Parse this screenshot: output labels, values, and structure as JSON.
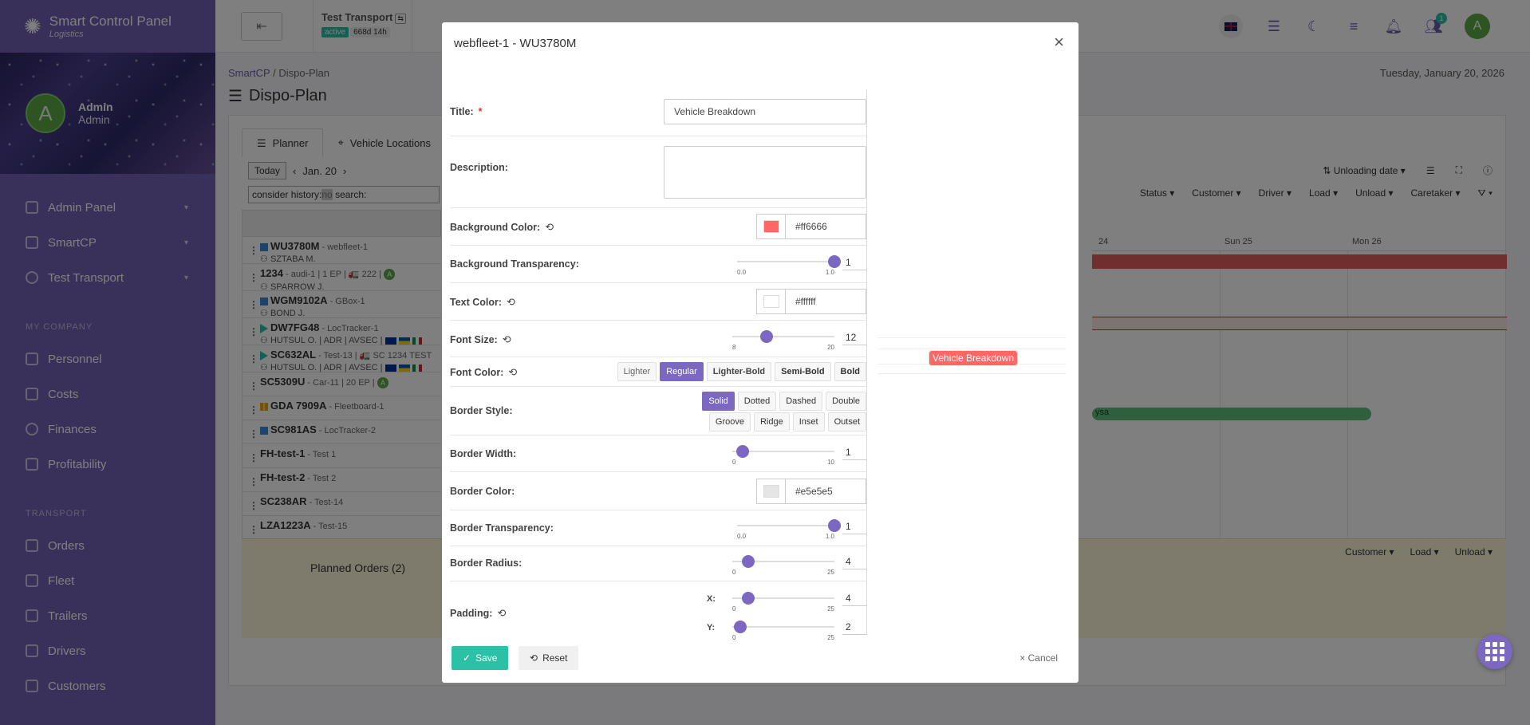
{
  "app": {
    "name": "Smart Control Panel",
    "sub": "Logistics"
  },
  "user": {
    "avatar": "A",
    "name": "Admin",
    "role": "Admin"
  },
  "sidebar": {
    "top": [
      {
        "label": "Admin Panel"
      },
      {
        "label": "SmartCP"
      },
      {
        "label": "Test Transport"
      }
    ],
    "sec1": "MY COMPANY",
    "company": [
      {
        "label": "Personnel"
      },
      {
        "label": "Costs"
      },
      {
        "label": "Finances"
      },
      {
        "label": "Profitability"
      }
    ],
    "sec2": "TRANSPORT",
    "transport": [
      {
        "label": "Orders"
      },
      {
        "label": "Fleet"
      },
      {
        "label": "Trailers"
      },
      {
        "label": "Drivers"
      },
      {
        "label": "Customers"
      }
    ]
  },
  "topbar": {
    "transport_title": "Test Transport",
    "status": "active",
    "duration": "668d 14h",
    "notif_count": "1",
    "user_avatar": "A"
  },
  "page": {
    "crumb_root": "SmartCP",
    "crumb_sep": "/",
    "crumb_current": "Dispo-Plan",
    "title": "Dispo-Plan",
    "date": "Tuesday, January 20, 2026"
  },
  "tabs": [
    "Planner",
    "Vehicle Locations"
  ],
  "planner": {
    "today": "Today",
    "current": "Jan. 20",
    "search_prefix": "consider history:",
    "search_no": "no",
    "search_label": "search:",
    "sort": "Unloading date",
    "filters": [
      "Status",
      "Customer",
      "Driver",
      "Load",
      "Unload",
      "Caretaker"
    ],
    "days": [
      "24",
      "Sun 25",
      "Mon 26"
    ],
    "green_bar_text": "ysa",
    "planned_orders": "Planned Orders (2)",
    "plan_filters": [
      "Customer",
      "Load",
      "Unload"
    ]
  },
  "vehicles": [
    {
      "plate": "WU3780M",
      "device": " - webfleet-1",
      "sub": "SZTABA M."
    },
    {
      "plate": "1234",
      "device": " - audi-1 | 1 EP | 🚛 222 |",
      "sub": "SPARROW J.",
      "badge": "A"
    },
    {
      "plate": "WGM9102A",
      "device": " - GBox-1",
      "sub": "BOND J."
    },
    {
      "plate": "DW7FG48",
      "device": " - LocTracker-1",
      "sub": "HUTSUL O. | ADR | AVSEC |"
    },
    {
      "plate": "SC632AL",
      "device": " - Test-13 | 🚛 SC 1234 TEST",
      "sub": "HUTSUL O. | ADR | AVSEC |"
    },
    {
      "plate": "SC5309U",
      "device": " - Car-11 | 20 EP |",
      "badge": "A"
    },
    {
      "plate": "GDA 7909A",
      "device": " - Fleetboard-1"
    },
    {
      "plate": "SC981AS",
      "device": " - LocTracker-2"
    },
    {
      "plate": "FH-test-1",
      "device": " - Test 1"
    },
    {
      "plate": "FH-test-2",
      "device": " - Test 2"
    },
    {
      "plate": "SC238AR",
      "device": " - Test-14"
    },
    {
      "plate": "LZA1223A",
      "device": " - Test-15"
    }
  ],
  "modal": {
    "title": "webfleet-1 - WU3780M",
    "labels": {
      "title": "Title:",
      "req": "*",
      "description": "Description:",
      "bg_color": "Background Color:",
      "bg_transp": "Background Transparency:",
      "text_color": "Text Color:",
      "font_size": "Font Size:",
      "font_color": "Font Color:",
      "border_style": "Border Style:",
      "border_width": "Border Width:",
      "border_color": "Border Color:",
      "border_transp": "Border Transparency:",
      "border_radius": "Border Radius:",
      "padding": "Padding:",
      "pad_x": "X:",
      "pad_y": "Y:"
    },
    "values": {
      "title": "Vehicle Breakdown",
      "description": "",
      "bg_color": "#ff6666",
      "bg_transp": "1",
      "text_color": "#ffffff",
      "font_size": "12",
      "border_width": "1",
      "border_color": "#e5e5e5",
      "border_transp": "1",
      "border_radius": "4",
      "pad_x": "4",
      "pad_y": "2"
    },
    "sliders": {
      "bg_transp": {
        "min": "0.0",
        "max": "1.0",
        "value": 1,
        "range": [
          0,
          1
        ]
      },
      "font_size": {
        "min": "8",
        "max": "20",
        "value": 12,
        "range": [
          8,
          20
        ]
      },
      "border_width": {
        "min": "0",
        "max": "10",
        "value": 1,
        "range": [
          0,
          10
        ]
      },
      "border_transp": {
        "min": "0.0",
        "max": "1.0",
        "value": 1,
        "range": [
          0,
          1
        ]
      },
      "border_radius": {
        "min": "0",
        "max": "25",
        "value": 4,
        "range": [
          0,
          25
        ]
      },
      "pad_x": {
        "min": "0",
        "max": "25",
        "value": 4,
        "range": [
          0,
          25
        ]
      },
      "pad_y": {
        "min": "0",
        "max": "25",
        "value": 2,
        "range": [
          0,
          25
        ]
      }
    },
    "font_weights": [
      "Lighter",
      "Regular",
      "Lighter-Bold",
      "Semi-Bold",
      "Bold"
    ],
    "font_weight_selected": "Regular",
    "border_styles_1": [
      "Solid",
      "Dotted",
      "Dashed",
      "Double"
    ],
    "border_styles_2": [
      "Groove",
      "Ridge",
      "Inset",
      "Outset"
    ],
    "border_style_selected": "Solid",
    "preview_text": "Vehicle Breakdown",
    "save": "Save",
    "reset": "Reset",
    "cancel": "Cancel"
  },
  "colors": {
    "accent": "#7c68c0",
    "teal": "#2cc1a6",
    "preview_bg": "#ff6666",
    "preview_border": "#e5e5e5",
    "text_white": "#ffffff"
  }
}
